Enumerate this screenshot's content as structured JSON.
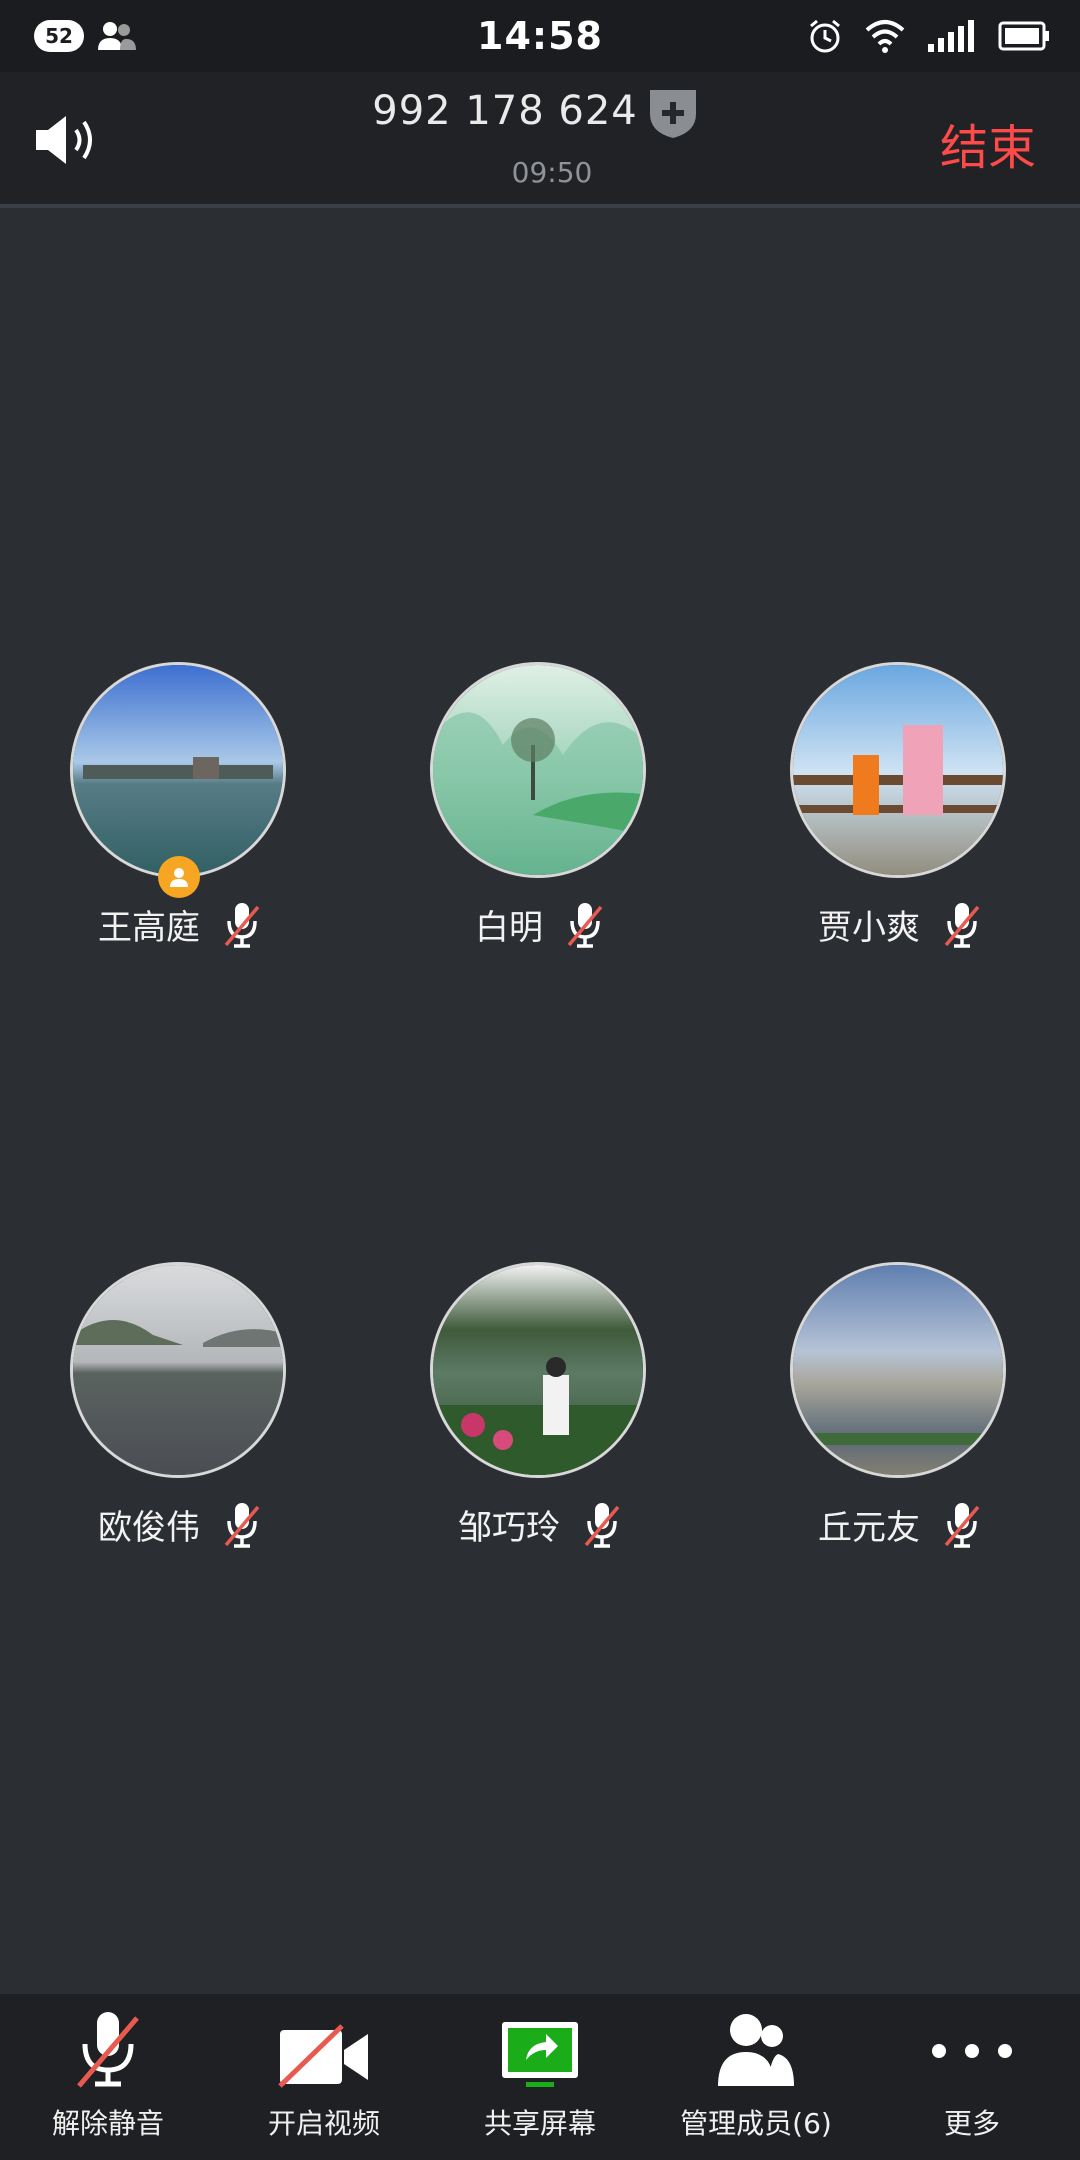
{
  "status_bar": {
    "badge_count": "52",
    "time": "14:58",
    "icons": [
      "users-icon",
      "alarm-icon",
      "wifi-icon",
      "signal-icon",
      "battery-icon"
    ]
  },
  "header": {
    "meeting_id": "992 178 624",
    "duration": "09:50",
    "end_label": "结束",
    "end_color": "#ff4a4a"
  },
  "participants": [
    {
      "name": "王高庭",
      "muted": true,
      "host": true
    },
    {
      "name": "白明",
      "muted": true,
      "host": false
    },
    {
      "name": "贾小爽",
      "muted": true,
      "host": false
    },
    {
      "name": "欧俊伟",
      "muted": true,
      "host": false
    },
    {
      "name": "邹巧玲",
      "muted": true,
      "host": false
    },
    {
      "name": "丘元友",
      "muted": true,
      "host": false
    }
  ],
  "toolbar": {
    "unmute_label": "解除静音",
    "video_label": "开启视频",
    "share_label": "共享屏幕",
    "members_label": "管理成员(6)",
    "more_label": "更多",
    "share_color": "#1aad19"
  }
}
